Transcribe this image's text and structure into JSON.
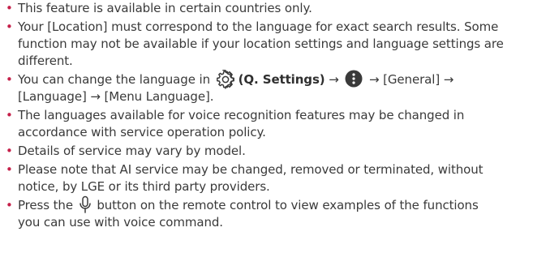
{
  "bullet_char": "•",
  "items": [
    {
      "lines": [
        "This feature is available in certain countries only."
      ]
    },
    {
      "lines": [
        "Your [Location] must correspond to the language for exact search results. Some",
        "function may not be available if your location settings and language settings are",
        "different."
      ]
    },
    {
      "line1_prefix": "You can change the language in ",
      "settings_label": "(Q. Settings)",
      "arrow": "→",
      "line1_suffix": "[General]",
      "line2": "[Language] → [Menu Language].",
      "icons": [
        "settings-gear-icon",
        "more-vertical-dots-icon"
      ]
    },
    {
      "lines": [
        "The languages available for voice recognition features may be changed in",
        "accordance with service operation policy."
      ]
    },
    {
      "lines": [
        "Details of service may vary by model."
      ]
    },
    {
      "lines": [
        "Please note that AI service may be changed, removed or terminated, without",
        "notice, by LGE or its third party providers."
      ]
    },
    {
      "line1_prefix": "Press the ",
      "line1_suffix": "button on the remote control to view examples of the functions",
      "line2": "you can use with voice command.",
      "icons": [
        "microphone-icon"
      ]
    }
  ],
  "colors": {
    "bullet": "#c5204a",
    "text": "#3a3a3a"
  }
}
